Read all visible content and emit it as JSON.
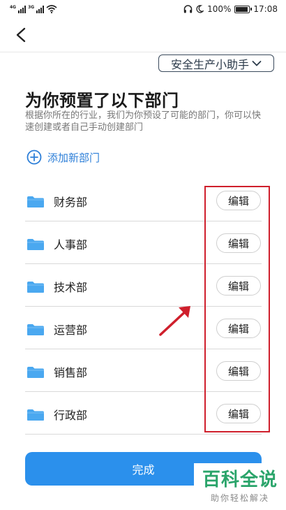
{
  "status_bar": {
    "network_1": "4G",
    "network_2": "3G",
    "battery_text": "100%",
    "battery_level": 1.0,
    "time": "17:08"
  },
  "header": {
    "assistant_label": "安全生产小助手"
  },
  "main": {
    "title": "为你预置了以下部门",
    "description": "根据你所在的行业，我们为你预设了可能的部门，你可以快速创建或者自己手动创建部门",
    "add_department_label": "添加新部门",
    "departments": [
      {
        "name": "财务部",
        "edit_label": "编辑"
      },
      {
        "name": "人事部",
        "edit_label": "编辑"
      },
      {
        "name": "技术部",
        "edit_label": "编辑"
      },
      {
        "name": "运营部",
        "edit_label": "编辑"
      },
      {
        "name": "销售部",
        "edit_label": "编辑"
      },
      {
        "name": "行政部",
        "edit_label": "编辑"
      }
    ],
    "done_label": "完成"
  },
  "watermark": {
    "title": "百科全说",
    "subtitle": "助你轻松解决"
  },
  "colors": {
    "accent": "#2b90ec",
    "link": "#2d7fd8",
    "folder": "#4aa8f0",
    "highlight": "#cf1f2c",
    "watermark": "#2aa46a"
  },
  "icons": {
    "back": "chevron-left-icon",
    "add": "plus-circle-icon",
    "folder": "folder-icon",
    "dropdown": "chevron-down-icon",
    "annotation": "arrow-icon"
  }
}
